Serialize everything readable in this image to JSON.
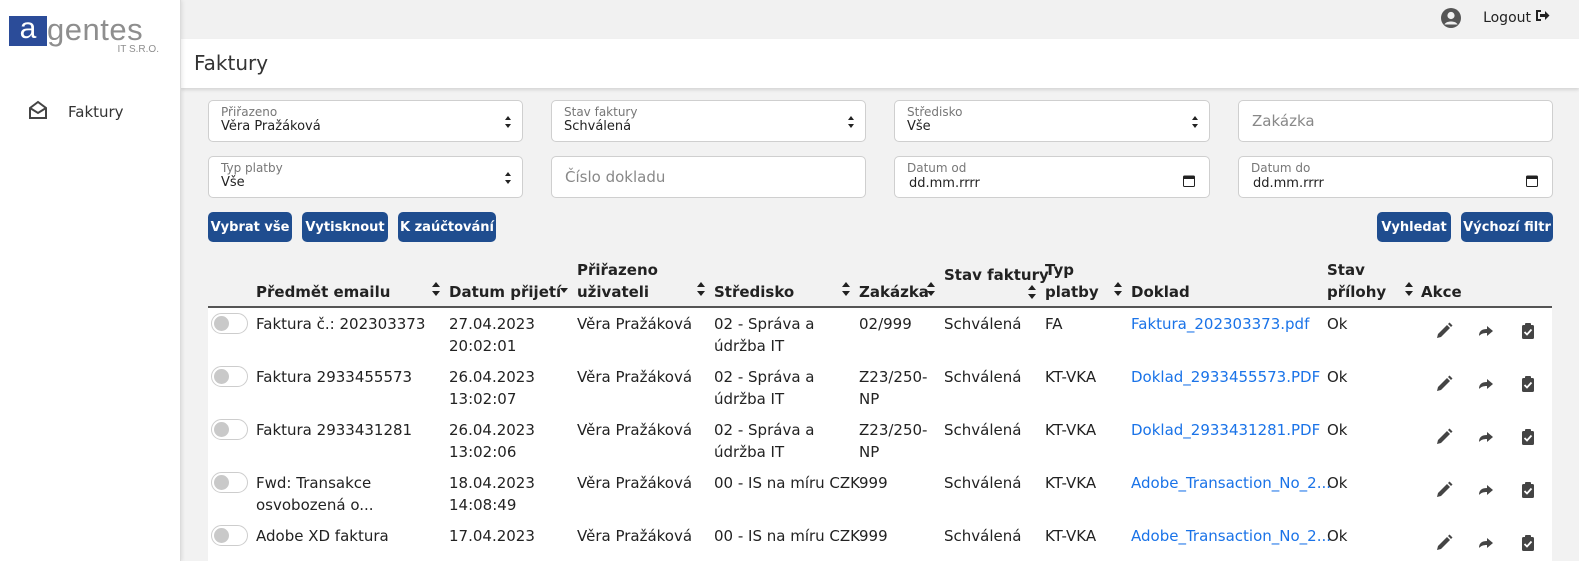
{
  "logo": {
    "main_letter": "a",
    "main_rest": "gentes",
    "sub": "IT S.R.O."
  },
  "sidebar": {
    "items": [
      {
        "label": "Faktury",
        "icon": "envelope-open-icon"
      }
    ]
  },
  "topbar": {
    "user_icon": "user-circle-icon",
    "logout_label": "Logout",
    "logout_icon": "sign-out-icon"
  },
  "page": {
    "title": "Faktury"
  },
  "filters": {
    "prirazeno": {
      "label": "Přiřazeno",
      "value": "Věra Pražáková"
    },
    "stav_faktury": {
      "label": "Stav faktury",
      "value": "Schválená"
    },
    "stredisko": {
      "label": "Středisko",
      "value": "Vše"
    },
    "zakazka": {
      "placeholder": "Zakázka"
    },
    "typ_platby": {
      "label": "Typ platby",
      "value": "Vše"
    },
    "cislo_dokladu": {
      "placeholder": "Číslo dokladu"
    },
    "datum_od": {
      "label": "Datum od",
      "value": "dd.mm.rrrr"
    },
    "datum_do": {
      "label": "Datum do",
      "value": "dd.mm.rrrr"
    }
  },
  "buttons": {
    "vybrat_vse": "Vybrat vše",
    "vytisknout": "Vytisknout",
    "k_zauctovani": "K zaúčtování",
    "vyhledat": "Vyhledat",
    "vychozi_filtr": "Výchozí filtr"
  },
  "table": {
    "headers": {
      "predmet": "Předmět emailu",
      "datum": "Datum přijetí",
      "prirazeno_1": "Přiřazeno",
      "prirazeno_2": "uživateli",
      "stredisko": "Středisko",
      "zakazka": "Zakázka",
      "stav_faktury": "Stav faktury",
      "typ_1": "Typ",
      "typ_2": "platby",
      "doklad": "Doklad",
      "stav_prilohy_1": "Stav",
      "stav_prilohy_2": "přílohy",
      "akce": "Akce"
    },
    "rows": [
      {
        "predmet_1": "Faktura č.: 202303373",
        "predmet_2": "",
        "datum_1": "27.04.2023",
        "datum_2": "20:02:01",
        "prirazeno": "Věra Pražáková",
        "stredisko_1": "02 - Správa a",
        "stredisko_2": "údržba IT",
        "zakazka_1": "02/999",
        "zakazka_2": "",
        "stav": "Schválená",
        "typ": "FA",
        "doklad": "Faktura_202303373.pdf",
        "stav_prilohy": "Ok"
      },
      {
        "predmet_1": "Faktura 2933455573",
        "predmet_2": "",
        "datum_1": "26.04.2023",
        "datum_2": "13:02:07",
        "prirazeno": "Věra Pražáková",
        "stredisko_1": "02 - Správa a",
        "stredisko_2": "údržba IT",
        "zakazka_1": "Z23/250-",
        "zakazka_2": "NP",
        "stav": "Schválená",
        "typ": "KT-VKA",
        "doklad": "Doklad_2933455573.PDF",
        "stav_prilohy": "Ok"
      },
      {
        "predmet_1": "Faktura 2933431281",
        "predmet_2": "",
        "datum_1": "26.04.2023",
        "datum_2": "13:02:06",
        "prirazeno": "Věra Pražáková",
        "stredisko_1": "02 - Správa a",
        "stredisko_2": "údržba IT",
        "zakazka_1": "Z23/250-",
        "zakazka_2": "NP",
        "stav": "Schválená",
        "typ": "KT-VKA",
        "doklad": "Doklad_2933431281.PDF",
        "stav_prilohy": "Ok"
      },
      {
        "predmet_1": "Fwd: Transakce",
        "predmet_2": "osvobozená o...",
        "datum_1": "18.04.2023",
        "datum_2": "14:08:49",
        "prirazeno": "Věra Pražáková",
        "stredisko_1": "00 - IS na míru CZK",
        "stredisko_2": "",
        "zakazka_1": "999",
        "zakazka_2": "",
        "stav": "Schválená",
        "typ": "KT-VKA",
        "doklad": "Adobe_Transaction_No_2...",
        "stav_prilohy": "Ok"
      },
      {
        "predmet_1": "Adobe XD faktura",
        "predmet_2": "",
        "datum_1": "17.04.2023",
        "datum_2": "",
        "prirazeno": "Věra Pražáková",
        "stredisko_1": "00 - IS na míru CZK",
        "stredisko_2": "",
        "zakazka_1": "999",
        "zakazka_2": "",
        "stav": "Schválená",
        "typ": "KT-VKA",
        "doklad": "Adobe_Transaction_No_2...",
        "stav_prilohy": "Ok"
      }
    ],
    "action_icons": [
      "pencil-icon",
      "share-arrow-icon",
      "clipboard-check-icon"
    ]
  },
  "colors": {
    "primary": "#1f4d8f",
    "link": "#1a73e8",
    "logo_blue": "#2b4c99"
  }
}
